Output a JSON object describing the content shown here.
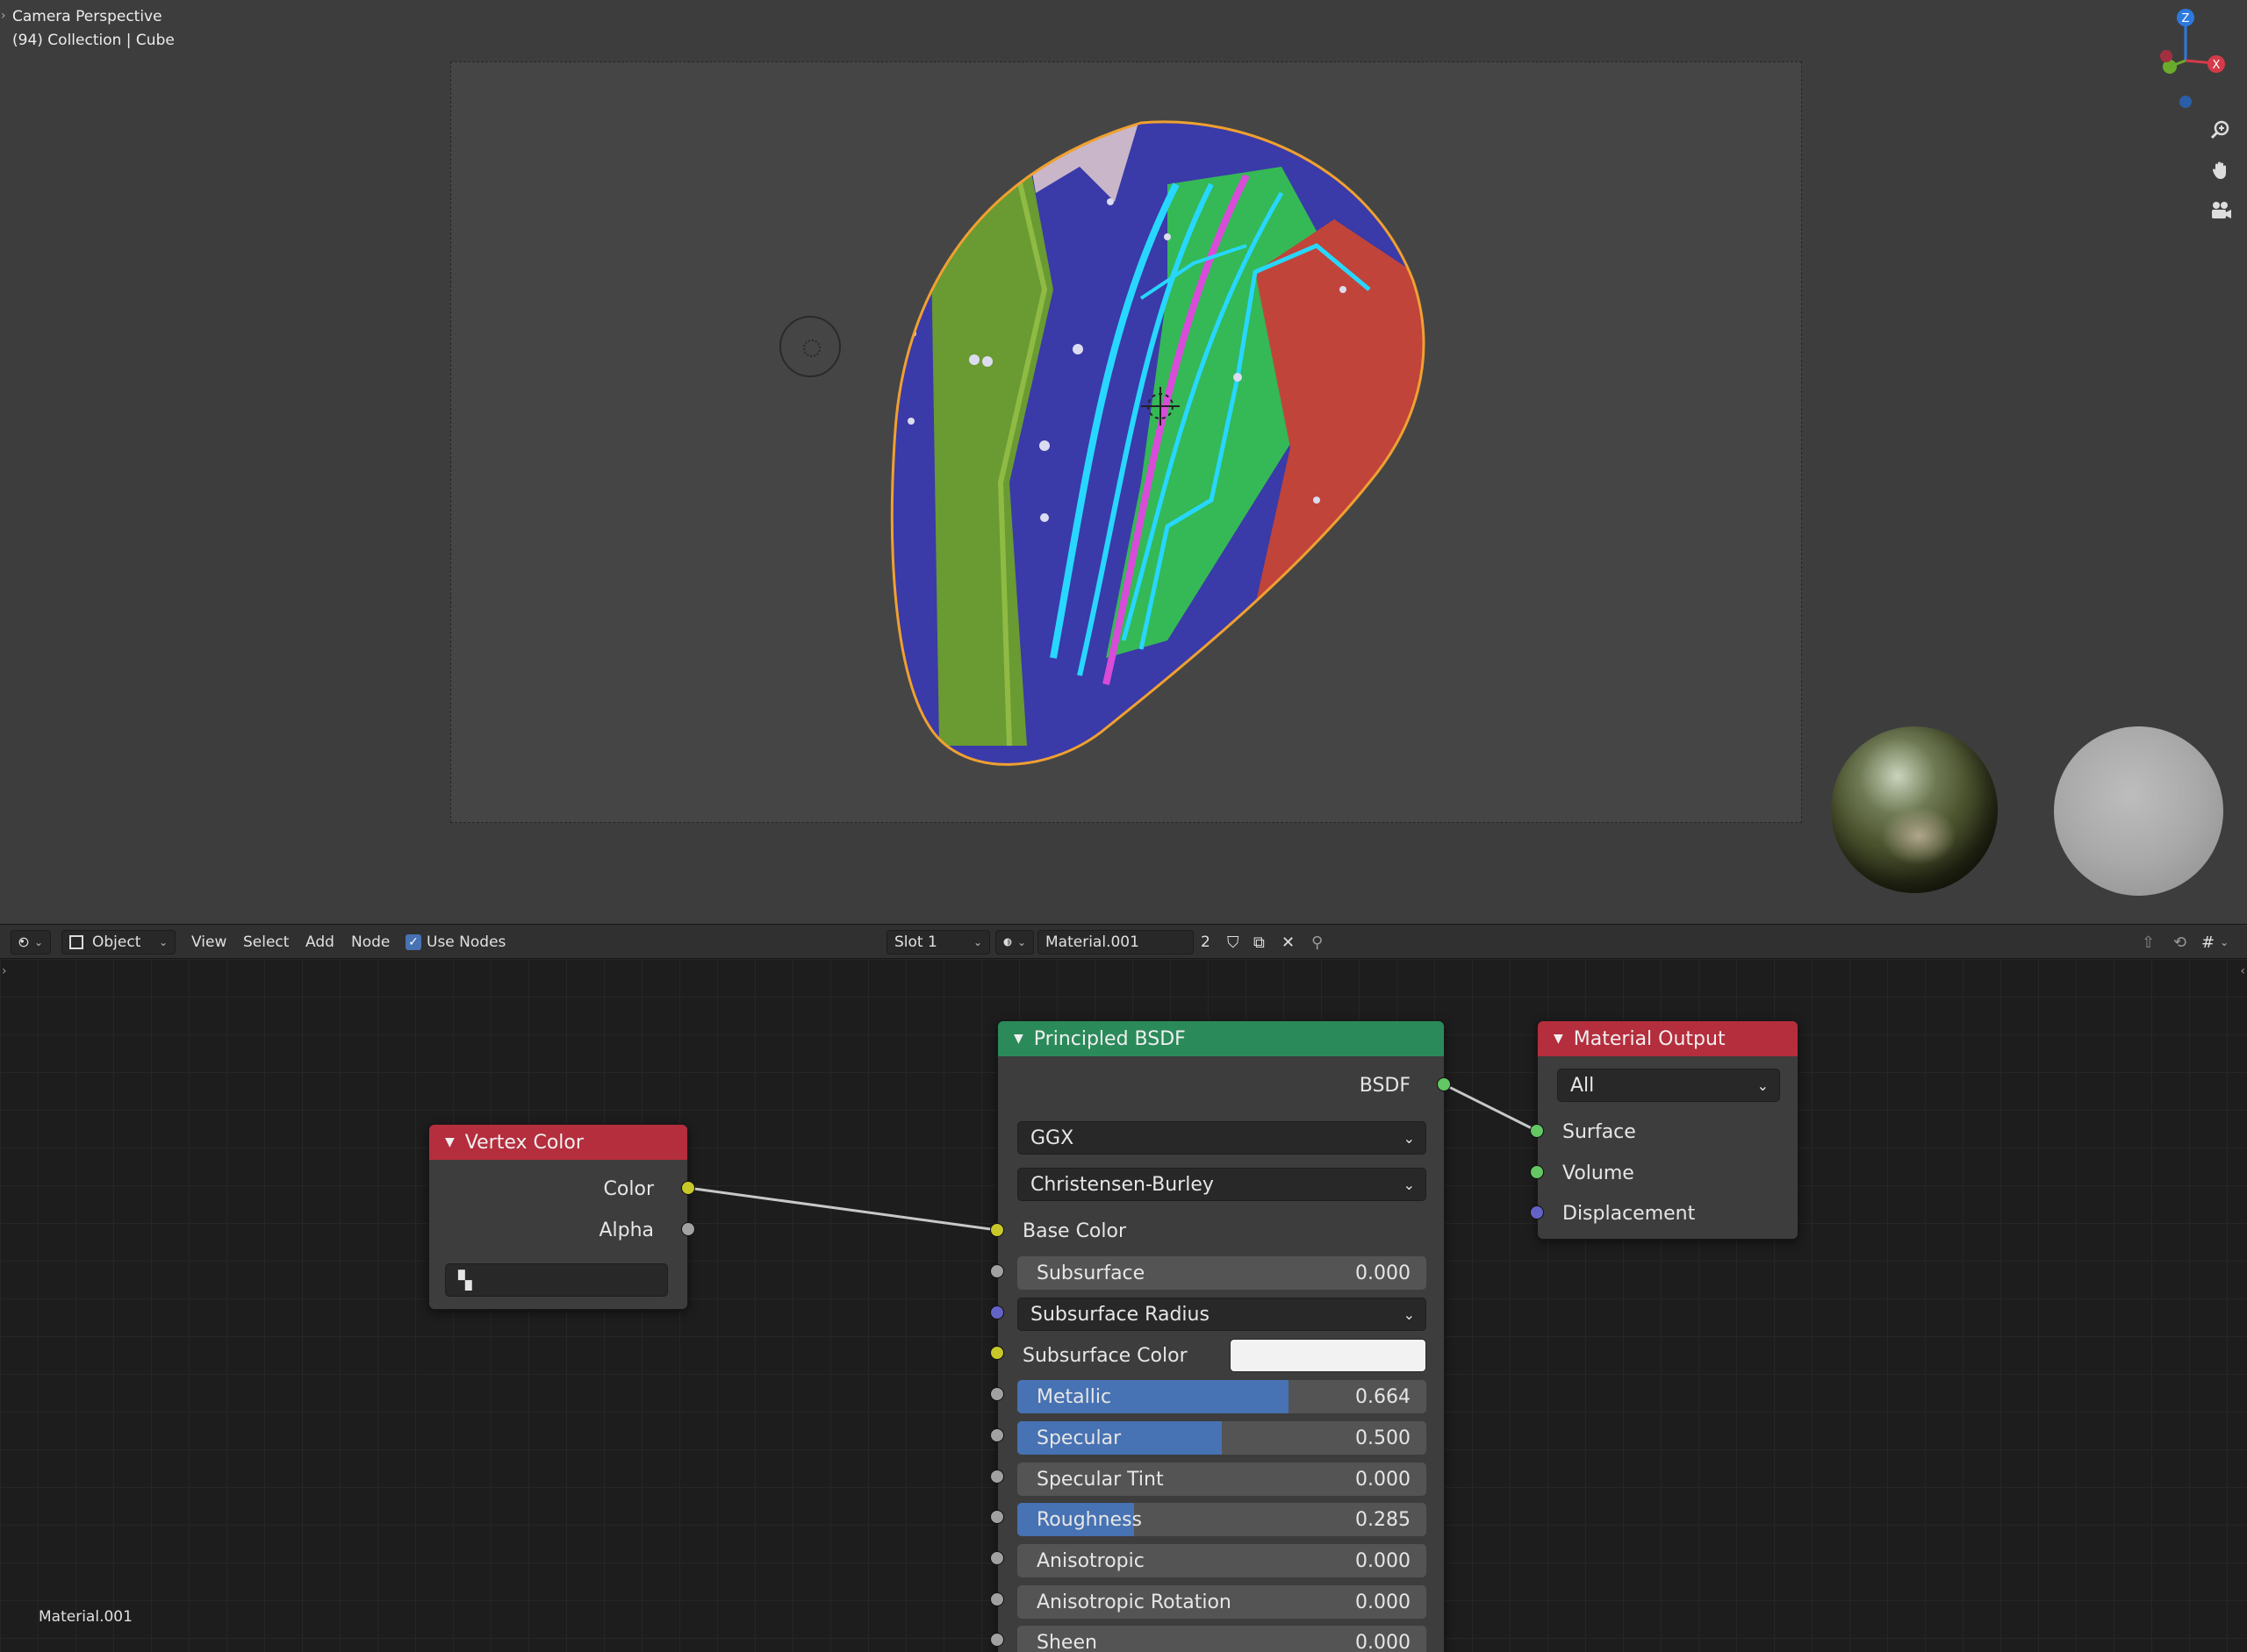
{
  "viewport": {
    "line1": "Camera Perspective",
    "line2": "(94) Collection | Cube",
    "gizmo": {
      "z": "Z",
      "x": "X"
    },
    "nav_icons": [
      "zoom-icon",
      "pan-hand-icon",
      "camera-view-icon"
    ]
  },
  "header": {
    "editor_type_icon": "shader-editor-icon",
    "mode_label": "Object",
    "menus": [
      "View",
      "Select",
      "Add",
      "Node"
    ],
    "use_nodes_label": "Use Nodes",
    "use_nodes_checked": true,
    "slot_label": "Slot 1",
    "material_name": "Material.001",
    "user_count": "2"
  },
  "nodes": {
    "vertex_color": {
      "title": "Vertex Color",
      "outputs": [
        "Color",
        "Alpha"
      ],
      "layer_value": ""
    },
    "principled": {
      "title": "Principled BSDF",
      "output": "BSDF",
      "distribution": "GGX",
      "subsurface_method": "Christensen-Burley",
      "base_color_label": "Base Color",
      "subsurface_radius_label": "Subsurface Radius",
      "subsurface_color_label": "Subsurface Color",
      "sliders": [
        {
          "label": "Subsurface",
          "value": "0.000",
          "fraction": 0
        },
        {
          "label": "Metallic",
          "value": "0.664",
          "fraction": 0.664
        },
        {
          "label": "Specular",
          "value": "0.500",
          "fraction": 0.5
        },
        {
          "label": "Specular Tint",
          "value": "0.000",
          "fraction": 0
        },
        {
          "label": "Roughness",
          "value": "0.285",
          "fraction": 0.285
        },
        {
          "label": "Anisotropic",
          "value": "0.000",
          "fraction": 0
        },
        {
          "label": "Anisotropic Rotation",
          "value": "0.000",
          "fraction": 0
        },
        {
          "label": "Sheen",
          "value": "0.000",
          "fraction": 0
        }
      ]
    },
    "material_output": {
      "title": "Material Output",
      "target": "All",
      "inputs": [
        "Surface",
        "Volume",
        "Displacement"
      ]
    }
  },
  "footer_material_label": "Material.001",
  "colors": {
    "shader_node_header": "#2b8a5a",
    "output_node_header": "#b52e3d",
    "input_node_header": "#b52e3d",
    "slider_fill": "#4772b3"
  }
}
